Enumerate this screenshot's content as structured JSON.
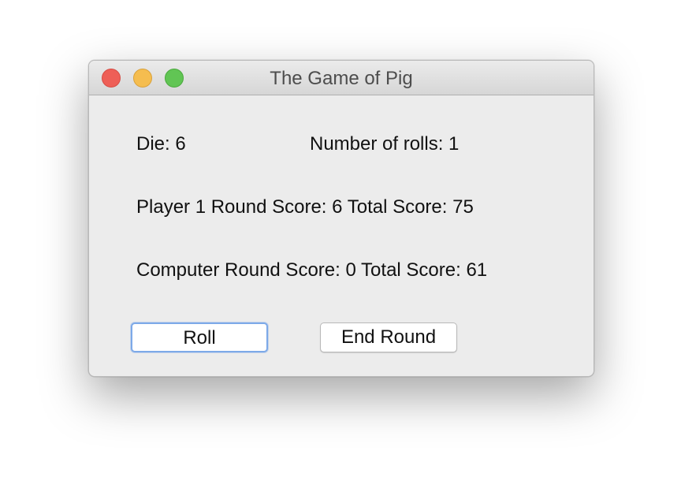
{
  "window": {
    "title": "The Game of Pig"
  },
  "game": {
    "die_text": "Die: 6",
    "rolls_text": "Number of rolls: 1",
    "player_text": "Player 1 Round Score: 6 Total Score: 75",
    "computer_text": "Computer Round Score: 0 Total Score: 61"
  },
  "buttons": {
    "roll_label": "Roll",
    "end_round_label": "End Round"
  },
  "colors": {
    "close": "#ee5f57",
    "minimize": "#f5bd4f",
    "zoom": "#61c554",
    "focus_ring": "#7da9e8"
  }
}
